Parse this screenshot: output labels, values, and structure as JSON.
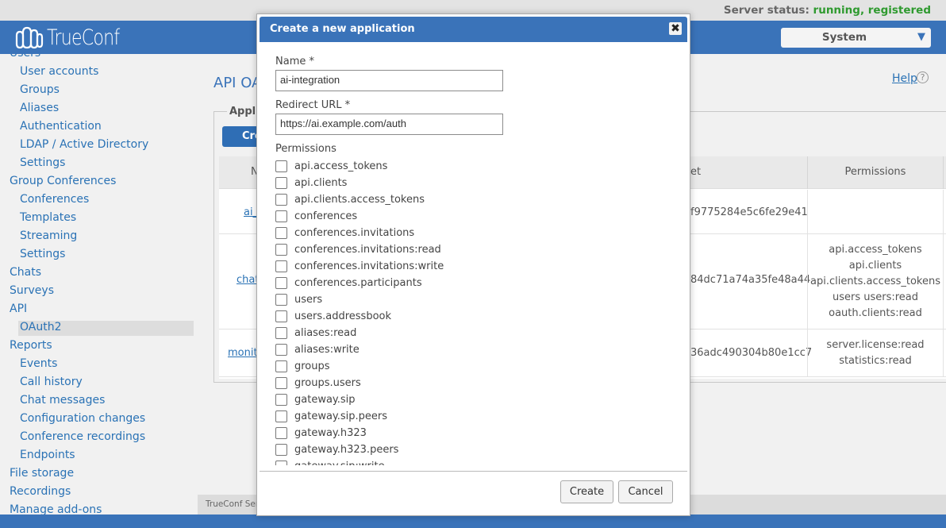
{
  "status": {
    "label": "Server status:",
    "value": "running, registered"
  },
  "header": {
    "logo_text": "TrueConf",
    "system_select": "System"
  },
  "sidebar": {
    "items": [
      {
        "label": "Users",
        "sub": false
      },
      {
        "label": "User accounts",
        "sub": true
      },
      {
        "label": "Groups",
        "sub": true
      },
      {
        "label": "Aliases",
        "sub": true
      },
      {
        "label": "Authentication",
        "sub": true
      },
      {
        "label": "LDAP / Active Directory",
        "sub": true
      },
      {
        "label": "Settings",
        "sub": true
      },
      {
        "label": "Group Conferences",
        "sub": false
      },
      {
        "label": "Conferences",
        "sub": true
      },
      {
        "label": "Templates",
        "sub": true
      },
      {
        "label": "Streaming",
        "sub": true
      },
      {
        "label": "Settings",
        "sub": true
      },
      {
        "label": "Chats",
        "sub": false
      },
      {
        "label": "Surveys",
        "sub": false
      },
      {
        "label": "API",
        "sub": false
      },
      {
        "label": "OAuth2",
        "sub": true,
        "active": true
      },
      {
        "label": "Reports",
        "sub": false
      },
      {
        "label": "Events",
        "sub": true
      },
      {
        "label": "Call history",
        "sub": true
      },
      {
        "label": "Chat messages",
        "sub": true
      },
      {
        "label": "Configuration changes",
        "sub": true
      },
      {
        "label": "Conference recordings",
        "sub": true
      },
      {
        "label": "Endpoints",
        "sub": true
      },
      {
        "label": "File storage",
        "sub": false
      },
      {
        "label": "Recordings",
        "sub": false
      },
      {
        "label": "Manage add-ons",
        "sub": false
      }
    ]
  },
  "main": {
    "title": "API OA",
    "help": "Help",
    "legend": "Appli",
    "create_button": "Cre",
    "table": {
      "col_name": "N",
      "col_secret": "et",
      "col_permissions": "Permissions",
      "rows": [
        {
          "name": "ai_",
          "secret": "f9775284e5c6fe29e41",
          "permissions": []
        },
        {
          "name": "chat",
          "secret": "84dc71a74a35fe48a44",
          "permissions": [
            "api.access_tokens",
            "api.clients",
            "api.clients.access_tokens",
            "users users:read",
            "oauth.clients:read"
          ]
        },
        {
          "name": "monit",
          "secret": "36adc490304b80e1cc7",
          "permissions": [
            "server.license:read",
            "statistics:read"
          ]
        }
      ]
    },
    "footer_text": "TrueConf Serv"
  },
  "modal": {
    "title": "Create a new application",
    "name_label": "Name *",
    "name_value": "ai-integration",
    "redirect_label": "Redirect URL *",
    "redirect_value": "https://ai.example.com/auth",
    "permissions_label": "Permissions",
    "permissions": [
      "api.access_tokens",
      "api.clients",
      "api.clients.access_tokens",
      "conferences",
      "conferences.invitations",
      "conferences.invitations:read",
      "conferences.invitations:write",
      "conferences.participants",
      "users",
      "users.addressbook",
      "aliases:read",
      "aliases:write",
      "groups",
      "groups.users",
      "gateway.sip",
      "gateway.sip.peers",
      "gateway.h323",
      "gateway.h323.peers",
      "gateway.sip:write"
    ],
    "create_button": "Create",
    "cancel_button": "Cancel"
  },
  "colors": {
    "brand": "#3a73b9",
    "link": "#2a72b5",
    "status_ok": "#2f9a2f"
  }
}
